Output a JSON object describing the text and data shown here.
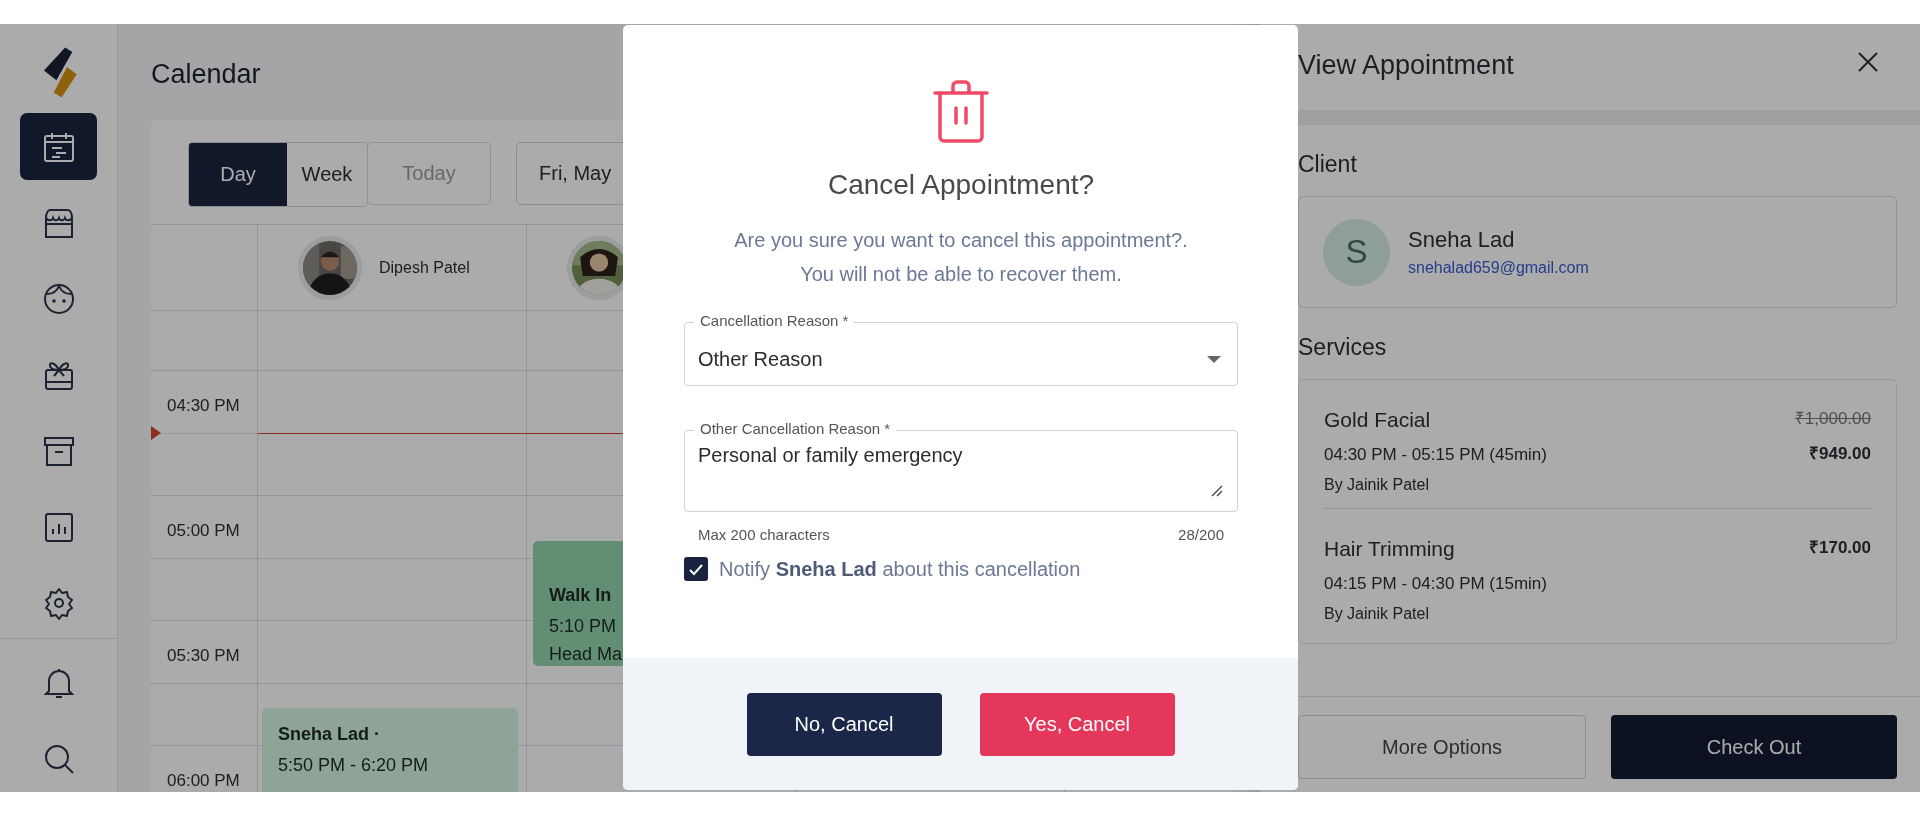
{
  "sidebar": {
    "items": [
      {
        "kind": "calendar",
        "selected": true
      },
      {
        "kind": "store",
        "selected": false
      },
      {
        "kind": "face",
        "selected": false
      },
      {
        "kind": "gift",
        "selected": false
      },
      {
        "kind": "archive",
        "selected": false
      },
      {
        "kind": "chart",
        "selected": false
      },
      {
        "kind": "settings",
        "selected": false
      }
    ],
    "bottom_items": [
      {
        "kind": "bell",
        "selected": false
      },
      {
        "kind": "search",
        "selected": false
      }
    ]
  },
  "calendar": {
    "title": "Calendar",
    "views": [
      {
        "label": "Day",
        "selected": true
      },
      {
        "label": "Week",
        "selected": false
      }
    ],
    "today": "Today",
    "date": "Fri, May",
    "staff": [
      {
        "name": "Dipesh Patel",
        "events": [
          {
            "title": "Sneha Lad ·",
            "time": "5:50 PM - 6:20 PM"
          }
        ]
      },
      {
        "events": [
          {
            "title": "Walk In",
            "time": "5:10 PM",
            "service": "Head Ma"
          }
        ]
      }
    ],
    "times": [
      "04:30 PM",
      "05:00 PM",
      "05:30 PM",
      "06:00 PM"
    ]
  },
  "panel": {
    "title": "View Appointment",
    "client": {
      "heading": "Client",
      "initial": "S",
      "name": "Sneha Lad",
      "email": "snehalad659@gmail.com"
    },
    "services": {
      "heading": "Services",
      "items": [
        {
          "name": "Gold Facial",
          "time": "04:30 PM - 05:15 PM (45min)",
          "by": "By Jainik Patel",
          "original_price": "₹1,000.00",
          "price": "₹949.00"
        },
        {
          "name": "Hair Trimming",
          "time": "04:15 PM - 04:30 PM (15min)",
          "by": "By Jainik Patel",
          "price": "₹170.00"
        }
      ]
    },
    "buttons": [
      {
        "label": "More Options",
        "kind": "outline"
      },
      {
        "label": "Check Out",
        "kind": "primary"
      }
    ]
  },
  "dialog": {
    "title": "Cancel Appointment?",
    "message_lines": [
      "Are you sure you want to cancel this appointment?.",
      "You will not be able to recover them."
    ],
    "reason": {
      "label": "Cancellation Reason *",
      "value": "Other Reason"
    },
    "other_reason": {
      "label": "Other Cancellation Reason *",
      "value": "Personal or family emergency",
      "helper": "Max 200 characters",
      "counter": "28/200"
    },
    "notify": {
      "text": "Notify **Sneha Lad** about this cancellation",
      "checked": true
    },
    "buttons": [
      {
        "label": "No, Cancel",
        "kind": "secondary"
      },
      {
        "label": "Yes, Cancel",
        "kind": "danger"
      }
    ]
  }
}
